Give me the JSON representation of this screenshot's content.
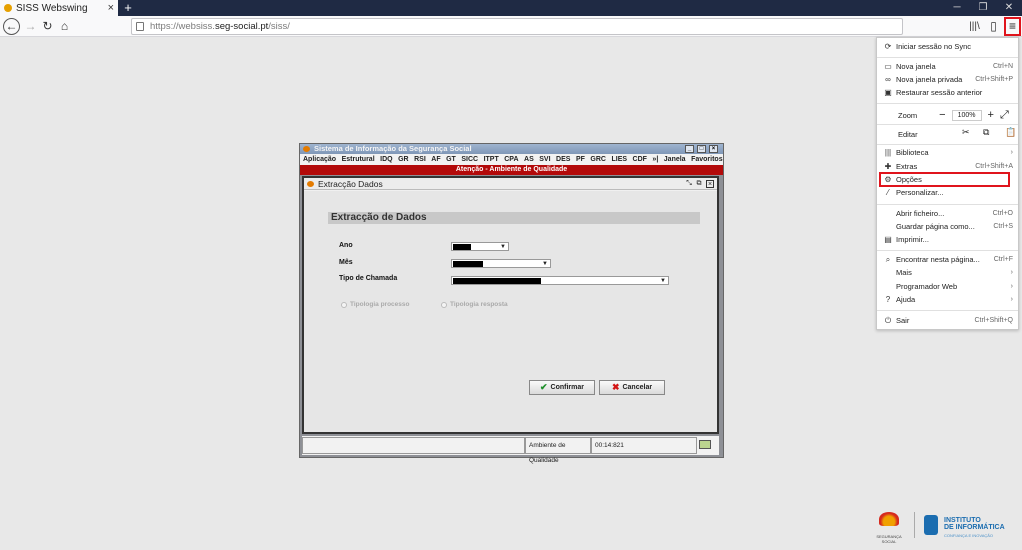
{
  "browser": {
    "tab_title": "SISS Webswing",
    "new_tab": "+",
    "tab_close": "×",
    "url_prefix": "https://websiss.",
    "url_domain": "seg-social.pt",
    "url_path": "/siss/",
    "win_minimize": "─",
    "win_maximize": "❐",
    "win_close": "✕"
  },
  "app": {
    "title": "Sistema de Informação da Segurança Social",
    "menu": [
      "Aplicação",
      "Estrutural",
      "IDQ",
      "GR",
      "RSI",
      "AF",
      "GT",
      "SICC",
      "ITPT",
      "CPA",
      "AS",
      "SVI",
      "DES",
      "PF",
      "GRC",
      "LIES",
      "CDF",
      "»|"
    ],
    "menu_right": [
      "Janela",
      "Favoritos"
    ],
    "alert": "Atenção - Ambiente de Qualidade",
    "inner_title": "Extracção Dados",
    "section_title": "Extracção de Dados",
    "fields": {
      "ano": "Ano",
      "mes": "Mês",
      "tipo": "Tipo de Chamada"
    },
    "radio_1": "Tipologia processo",
    "radio_2": "Tipologia resposta",
    "confirm": "Confirmar",
    "cancel": "Cancelar",
    "status_env": "Ambiente de Qualidade",
    "status_time": "00:14:821"
  },
  "ffmenu": {
    "sync": "Iniciar sessão no Sync",
    "new_window": "Nova janela",
    "new_window_sc": "Ctrl+N",
    "private": "Nova janela privada",
    "private_sc": "Ctrl+Shift+P",
    "restore": "Restaurar sessão anterior",
    "zoom": "Zoom",
    "zoom_minus": "−",
    "zoom_value": "100%",
    "zoom_plus": "+",
    "zoom_full": "⤢",
    "edit": "Editar",
    "library": "Biblioteca",
    "addons": "Extras",
    "addons_sc": "Ctrl+Shift+A",
    "options": "Opções",
    "customize": "Personalizar...",
    "open_file": "Abrir ficheiro...",
    "open_file_sc": "Ctrl+O",
    "save_page": "Guardar página como...",
    "save_page_sc": "Ctrl+S",
    "print": "Imprimir...",
    "find": "Encontrar nesta página...",
    "find_sc": "Ctrl+F",
    "more": "Mais",
    "webdev": "Programador Web",
    "help": "Ajuda",
    "quit": "Sair",
    "quit_sc": "Ctrl+Shift+Q"
  },
  "logos": {
    "seg_label": "SEGURANÇA SOCIAL",
    "ii_line1": "INSTITUTO",
    "ii_line2": "DE INFORMÁTICA",
    "ii_tag": "CONFIANÇA E INOVAÇÃO"
  }
}
